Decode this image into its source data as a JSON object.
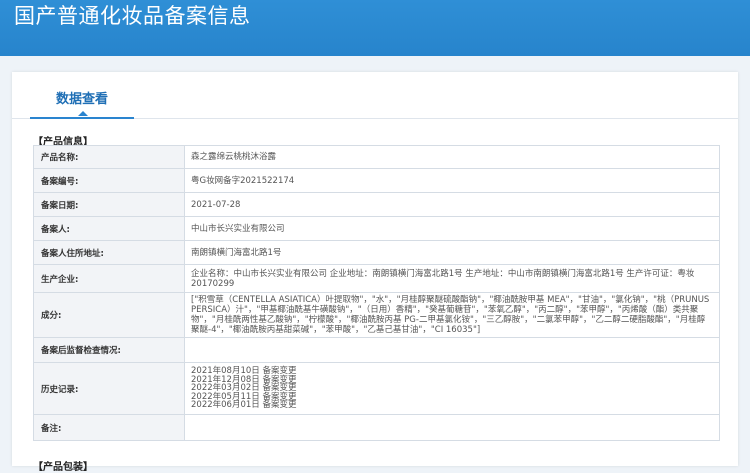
{
  "header": {
    "title": "国产普通化妆品备案信息"
  },
  "tabs": [
    {
      "label": "数据查看"
    }
  ],
  "sections": [
    "【产品信息】",
    "【产品包装】"
  ],
  "product_info": [
    {
      "label": "产品名称:",
      "value": "森之露绵云桃桃沐浴露"
    },
    {
      "label": "备案编号:",
      "value": "粤G妆网备字2021522174"
    },
    {
      "label": "备案日期:",
      "value": "2021-07-28"
    },
    {
      "label": "备案人:",
      "value": "中山市长兴实业有限公司"
    },
    {
      "label": "备案人住所地址:",
      "value": "南朗镇横门海富北路1号"
    },
    {
      "label": "生产企业:",
      "value": "企业名称：中山市长兴实业有限公司 企业地址：南朗镇横门海富北路1号 生产地址：中山市南朗镇横门海富北路1号 生产许可证：粤妆20170299"
    },
    {
      "label": "成分:",
      "value": "[\"积雪草（CENTELLA ASIATICA）叶提取物\"，\"水\"，\"月桂醇聚醚硫酸酯钠\"，\"椰油酰胺甲基 MEA\"，\"甘油\"，\"氯化钠\"，\"桃（PRUNUS PERSICA）汁\"，\"甲基椰油酰基牛磺酸钠\"，\"（日用）香精\"，\"癸基葡糖苷\"，\"苯氧乙醇\"，\"丙二醇\"，\"苯甲醇\"，\"丙烯酸（酯）类共聚物\"，\"月桂酰两性基乙酸钠\"，\"柠檬酸\"，\"椰油酰胺丙基 PG-二甲基氯化铵\"，\"三乙醇胺\"，\"二氯苯甲醇\"，\"乙二醇二硬脂酸酯\"，\"月桂醇聚醚-4\"，\"椰油酰胺丙基甜菜碱\"，\"苯甲酸\"，\"乙基己基甘油\"，\"CI 16035\"]"
    },
    {
      "label": "备案后监督检查情况:",
      "value": ""
    },
    {
      "label": "历史记录:",
      "value": ""
    },
    {
      "label": "备注:",
      "value": ""
    }
  ],
  "history": [
    "2021年08月10日 备案变更",
    "2021年12月08日 备案变更",
    "2022年03月02日 备案变更",
    "2022年05月11日 备案变更",
    "2022年06月01日 备案变更"
  ]
}
